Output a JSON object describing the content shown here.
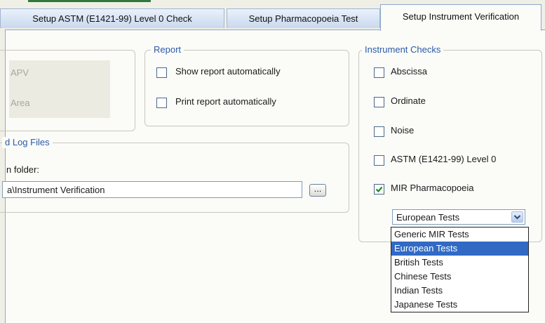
{
  "tabs": [
    {
      "label": "Setup ASTM (E1421-99) Level 0 Check"
    },
    {
      "label": "Setup Pharmacopoeia Test"
    },
    {
      "label": "Setup Instrument Verification"
    }
  ],
  "left_group": {
    "items": [
      "APV",
      "Area"
    ]
  },
  "report": {
    "legend": "Report",
    "checkboxes": [
      {
        "label": "Show report automatically",
        "checked": false
      },
      {
        "label": "Print report automatically",
        "checked": false
      }
    ]
  },
  "log_files": {
    "legend": "d Log Files",
    "folder_label": "n folder:",
    "path_value": "a\\Instrument Verification",
    "browse_label": "..."
  },
  "instrument_checks": {
    "legend": "Instrument Checks",
    "checkboxes": [
      {
        "label": "Abscissa",
        "checked": false
      },
      {
        "label": "Ordinate",
        "checked": false
      },
      {
        "label": "Noise",
        "checked": false
      },
      {
        "label": "ASTM (E1421-99) Level 0",
        "checked": false
      },
      {
        "label": "MIR Pharmacopoeia",
        "checked": true
      }
    ],
    "combo_value": "European Tests",
    "dropdown_options": [
      {
        "label": "Generic MIR Tests",
        "selected": false
      },
      {
        "label": "European Tests",
        "selected": true
      },
      {
        "label": "British Tests",
        "selected": false
      },
      {
        "label": "Chinese Tests",
        "selected": false
      },
      {
        "label": "Indian Tests",
        "selected": false
      },
      {
        "label": "Japanese Tests",
        "selected": false
      }
    ]
  },
  "colors": {
    "accent": "#316ac5",
    "legend_text": "#2a5aa8",
    "tab_gradient_bottom": "#c9d9ee",
    "check_mark": "#1e8a1e"
  }
}
